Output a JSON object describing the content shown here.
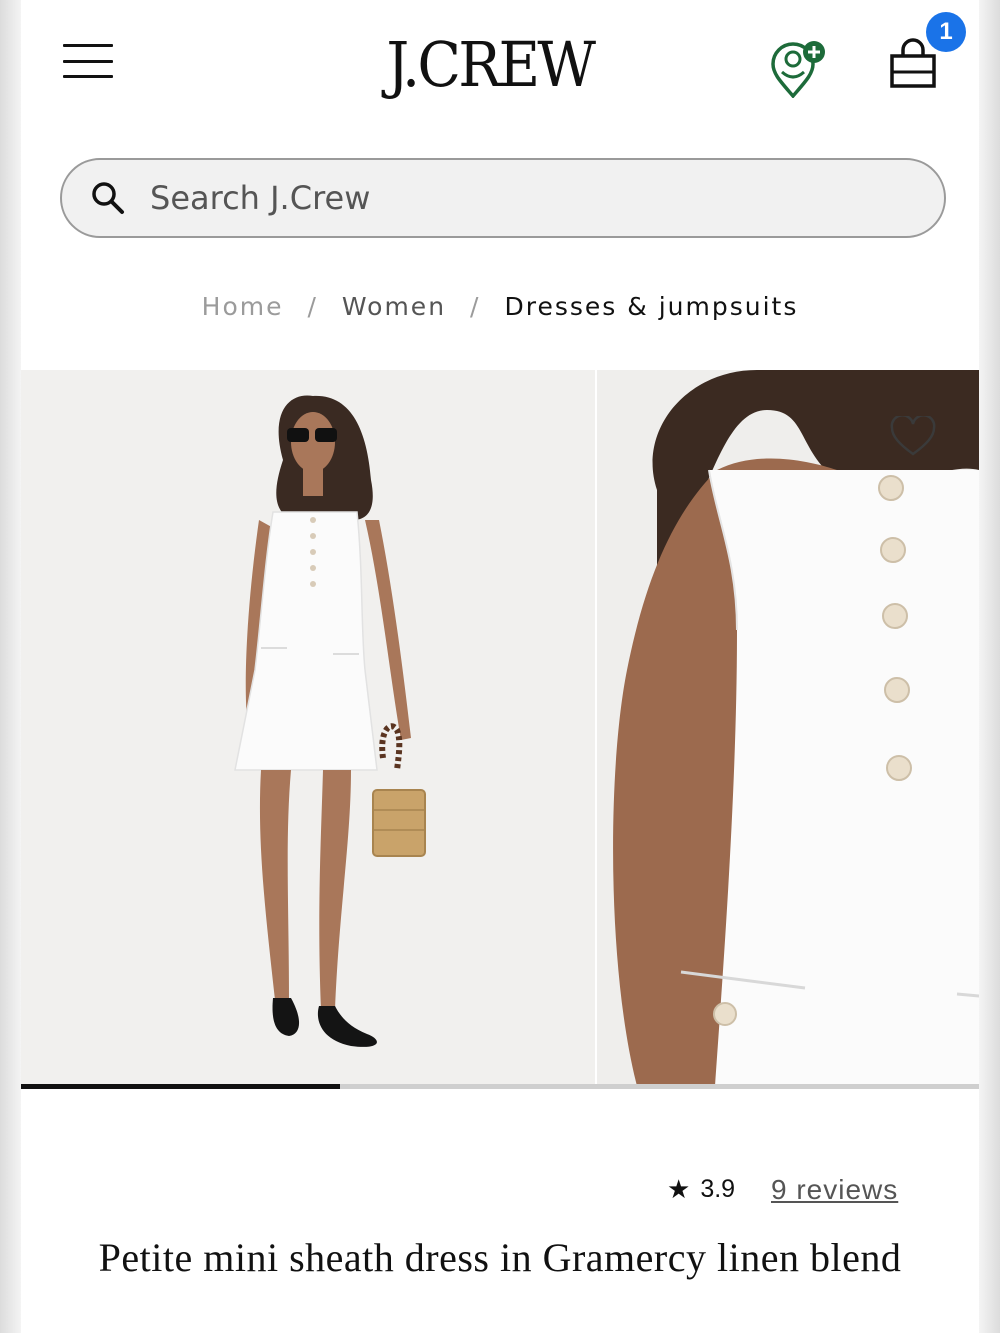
{
  "header": {
    "menu_icon": "hamburger-icon",
    "logo_text": "J.CREW",
    "rewards_icon": "rewards-icon",
    "bag_icon": "shopping-bag-icon",
    "cart_count": "1",
    "badge_color": "#1a73e8",
    "rewards_color": "#1d6b3a"
  },
  "search": {
    "placeholder": "Search J.Crew",
    "icon": "search-icon"
  },
  "breadcrumb": {
    "items": [
      "Home",
      "Women",
      "Dresses & jumpsuits"
    ],
    "separator": "/"
  },
  "gallery": {
    "images": [
      "full-length model photo",
      "button detail close-up photo"
    ],
    "progress_fraction": 0.333,
    "heart_icon": "heart-icon"
  },
  "product": {
    "rating": "3.9",
    "star": "★",
    "reviews_link": "9 reviews",
    "title": "Petite mini sheath dress in Gramercy linen blend"
  }
}
